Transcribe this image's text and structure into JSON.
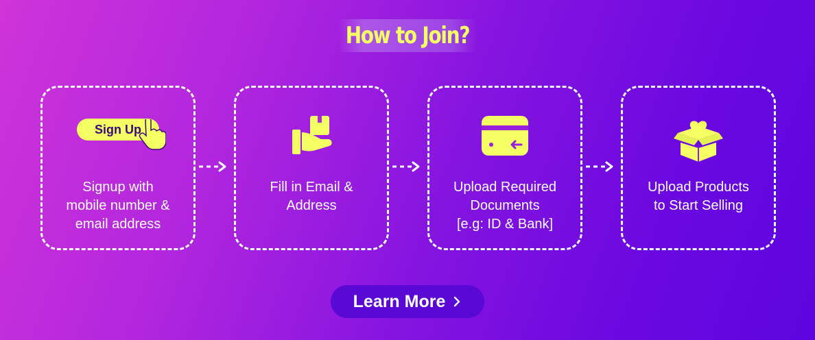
{
  "header": {
    "title": "How to Join?"
  },
  "steps": [
    {
      "badge": "Sign Up",
      "icon": "pointer-hand-icon",
      "lines": [
        "Signup with",
        "mobile number &",
        "email address"
      ]
    },
    {
      "icon": "hand-package-icon",
      "lines": [
        "Fill in Email &",
        "Address"
      ]
    },
    {
      "icon": "document-card-icon",
      "lines": [
        "Upload Required",
        "Documents",
        "[e.g: ID & Bank]"
      ]
    },
    {
      "icon": "heart-box-icon",
      "lines": [
        "Upload Products",
        "to Start Selling"
      ]
    }
  ],
  "cta": {
    "label": "Learn More",
    "icon": "chevron-right-icon"
  },
  "colors": {
    "accent": "#f4ff63",
    "button": "#5a08d4",
    "text": "#ffffff"
  }
}
